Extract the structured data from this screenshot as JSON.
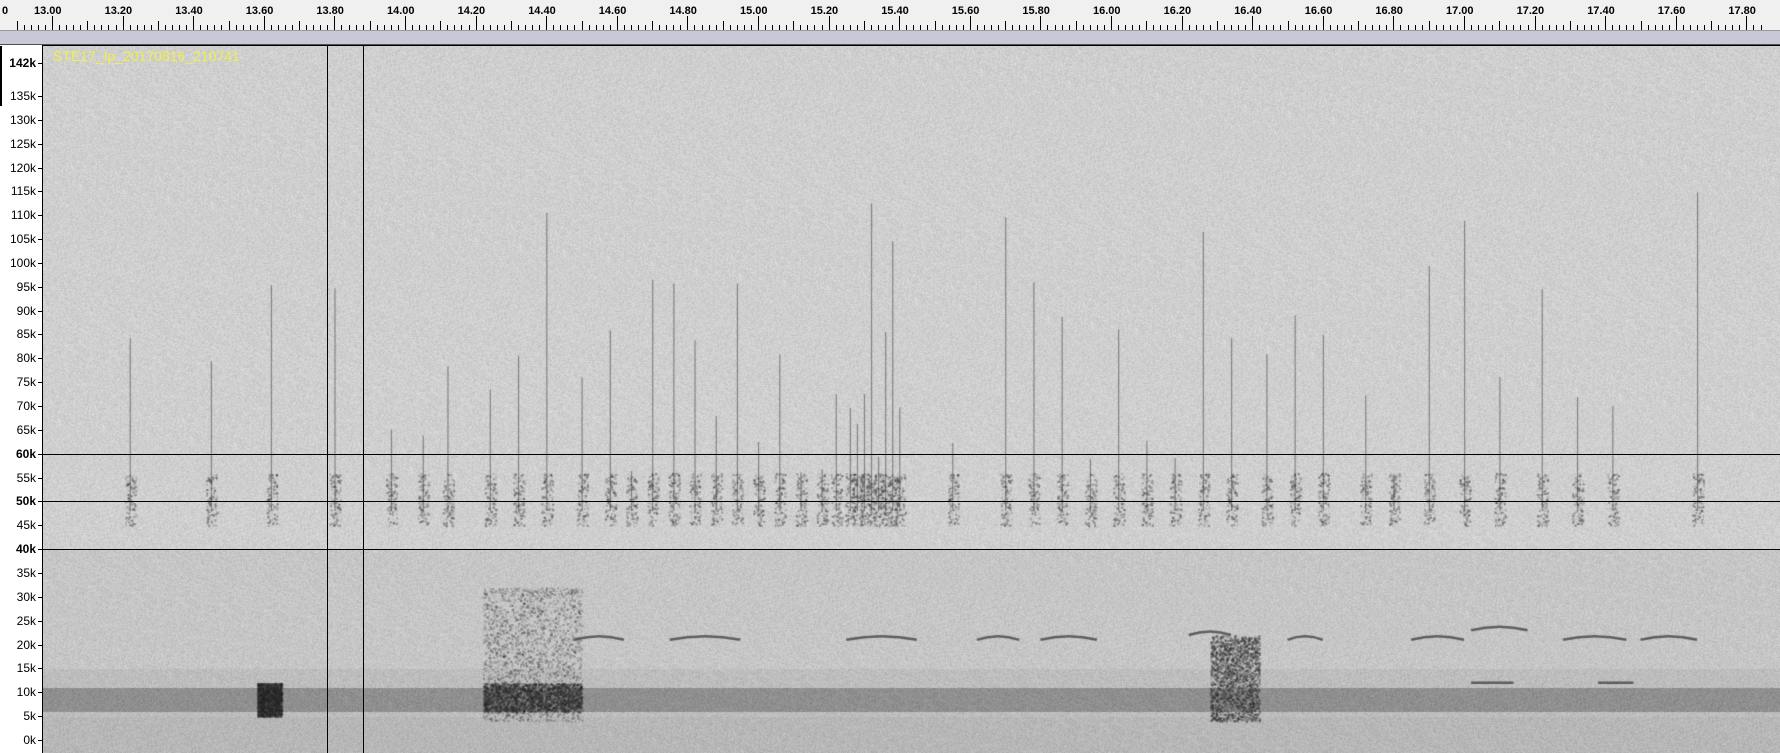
{
  "timeline": {
    "edge_label": "0",
    "labels": [
      "13.00",
      "13.20",
      "13.40",
      "13.60",
      "13.80",
      "14.00",
      "14.20",
      "14.40",
      "14.60",
      "14.80",
      "15.00",
      "15.20",
      "15.40",
      "15.60",
      "15.80",
      "16.00",
      "16.20",
      "16.40",
      "16.60",
      "16.80",
      "17.00",
      "17.20",
      "17.40",
      "17.60",
      "17.80"
    ],
    "start": 12.9,
    "end": 17.82
  },
  "frequency_axis": {
    "labels": [
      "142k",
      "135k",
      "130k",
      "125k",
      "120k",
      "115k",
      "110k",
      "105k",
      "100k",
      "95k",
      "90k",
      "85k",
      "80k",
      "75k",
      "70k",
      "65k",
      "60k",
      "55k",
      "50k",
      "45k",
      "40k",
      "35k",
      "30k",
      "25k",
      "20k",
      "15k",
      "10k",
      "5k",
      "0k"
    ],
    "values": [
      142,
      135,
      130,
      125,
      120,
      115,
      110,
      105,
      100,
      95,
      90,
      85,
      80,
      75,
      70,
      65,
      60,
      55,
      50,
      45,
      40,
      35,
      30,
      25,
      20,
      15,
      10,
      5,
      0
    ],
    "bold": [
      "142k",
      "60k",
      "50k",
      "40k"
    ],
    "max_khz": 144
  },
  "clip": {
    "name": "STE17_Ip_20170816_210741"
  },
  "selection": {
    "freq_lines_khz": [
      60,
      50,
      40
    ],
    "time_lines": [
      13.78,
      13.88
    ]
  },
  "colors": {
    "ruler_bg": "#f0f0f0",
    "track_strip": "#c8c8d8",
    "spectrogram_bg": "#d4d4d4",
    "clip_name": "#f0f04a"
  }
}
